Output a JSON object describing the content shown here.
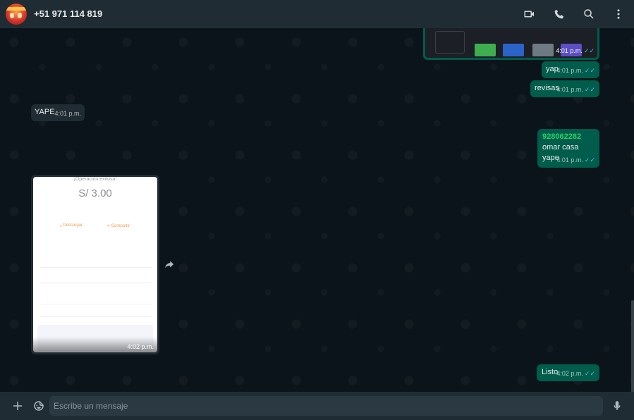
{
  "header": {
    "contact_name": "+51 971 114 819",
    "icons": [
      "video-call-icon",
      "voice-call-icon",
      "search-icon",
      "menu-icon"
    ]
  },
  "messages": [
    {
      "direction": "out",
      "type": "image",
      "time": "4:01 p.m.",
      "status": "read"
    },
    {
      "direction": "out",
      "type": "text",
      "text": "yap",
      "time": "4:01 p.m.",
      "status": "read"
    },
    {
      "direction": "out",
      "type": "text",
      "text": "revisas",
      "time": "4:01 p.m.",
      "status": "read"
    },
    {
      "direction": "in",
      "type": "text",
      "text": "YAPE",
      "time": "4:01 p.m."
    },
    {
      "direction": "out",
      "type": "text",
      "phone": "928062282",
      "line1": "omar casa",
      "line2": "yape",
      "time": "4:01 p.m.",
      "status": "read"
    },
    {
      "direction": "in",
      "type": "image",
      "time": "4:02 p.m.",
      "receipt": {
        "title": "¡Operación exitosa!",
        "amount": "S/ 3.00",
        "download": "Descargar",
        "share": "Compartir"
      }
    },
    {
      "direction": "out",
      "type": "text",
      "text": "Listo",
      "time": "4:02 p.m.",
      "status": "read"
    }
  ],
  "composer": {
    "placeholder": "Escribe un mensaje"
  },
  "colors": {
    "header_bg": "#202c33",
    "chat_bg": "#0b141a",
    "outgoing_bubble": "#005c4b",
    "incoming_bubble": "#202c33",
    "read_ticks": "#53bdeb",
    "phone_link": "#25d366"
  }
}
